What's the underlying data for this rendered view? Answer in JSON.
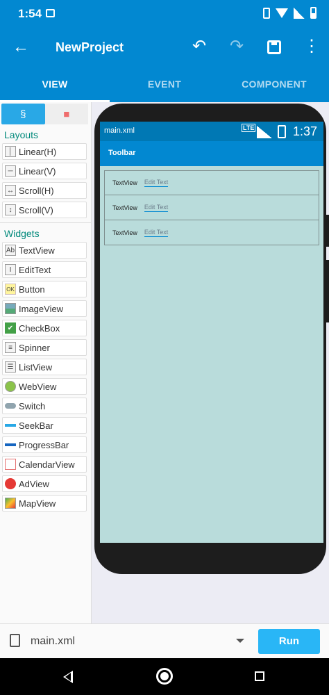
{
  "status_bar": {
    "time": "1:54"
  },
  "app_bar": {
    "title": "NewProject",
    "back_icon": "←",
    "undo_icon": "↶",
    "redo_icon": "↷",
    "more_icon": "⋮"
  },
  "tabs": [
    {
      "label": "VIEW",
      "active": true
    },
    {
      "label": "EVENT",
      "active": false
    },
    {
      "label": "COMPONENT",
      "active": false
    }
  ],
  "palette": {
    "tab_icons": [
      "§",
      "■"
    ],
    "layouts_header": "Layouts",
    "layouts": [
      {
        "label": "Linear(H)",
        "icon": "│"
      },
      {
        "label": "Linear(V)",
        "icon": "─"
      },
      {
        "label": "Scroll(H)",
        "icon": "↔"
      },
      {
        "label": "Scroll(V)",
        "icon": "↕"
      }
    ],
    "widgets_header": "Widgets",
    "widgets": [
      {
        "label": "TextView",
        "icon": "Ab"
      },
      {
        "label": "EditText",
        "icon": "I"
      },
      {
        "label": "Button",
        "icon": "OK"
      },
      {
        "label": "ImageView",
        "icon": ""
      },
      {
        "label": "CheckBox",
        "icon": "✔"
      },
      {
        "label": "Spinner",
        "icon": "≡"
      },
      {
        "label": "ListView",
        "icon": "☰"
      },
      {
        "label": "WebView",
        "icon": ""
      },
      {
        "label": "Switch",
        "icon": ""
      },
      {
        "label": "SeekBar",
        "icon": ""
      },
      {
        "label": "ProgressBar",
        "icon": ""
      },
      {
        "label": "CalendarView",
        "icon": ""
      },
      {
        "label": "AdView",
        "icon": ""
      },
      {
        "label": "MapView",
        "icon": ""
      }
    ]
  },
  "preview": {
    "file_name": "main.xml",
    "network": "LTE",
    "time": "1:37",
    "toolbar_title": "Toolbar",
    "rows": [
      {
        "text": "TextView",
        "edit": "Edit Text"
      },
      {
        "text": "TextView",
        "edit": "Edit Text"
      },
      {
        "text": "TextView",
        "edit": "Edit Text"
      }
    ]
  },
  "bottom_bar": {
    "file_name": "main.xml",
    "run_label": "Run"
  }
}
